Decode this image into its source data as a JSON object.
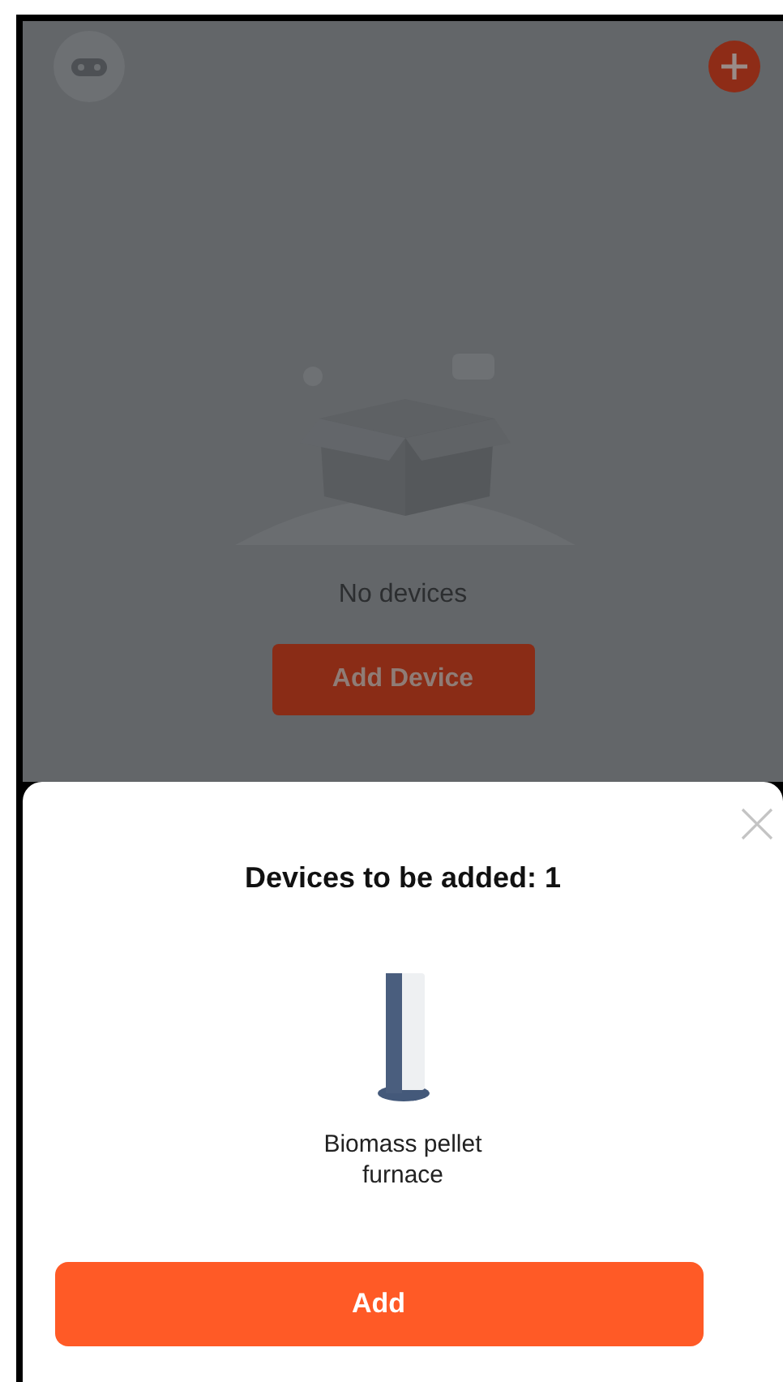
{
  "empty_state": {
    "message": "No devices",
    "button": "Add Device"
  },
  "sheet": {
    "title": "Devices to be added: 1",
    "devices": [
      {
        "name": "Biomass pellet furnace"
      }
    ],
    "button": "Add"
  }
}
